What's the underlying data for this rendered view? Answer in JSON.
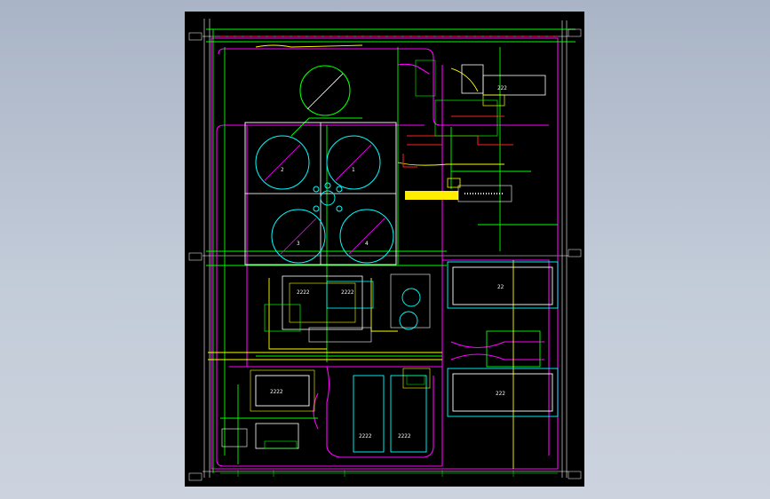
{
  "drawing": {
    "background": "#000000",
    "colors": {
      "boundary": "#ff00ff",
      "road": "#ff00ff",
      "pipe_green": "#00ff00",
      "pipe_yellow": "#ffff00",
      "pipe_red": "#ff2020",
      "grid_white": "#ffffff",
      "cyan": "#00ffff",
      "dim": "#00ff00"
    },
    "tank_labels": [
      "2",
      "1",
      "3",
      "4"
    ],
    "pool_labels": [
      "2222",
      "2222",
      "2222",
      "2222"
    ],
    "building_labels": [
      "22",
      "222",
      "222",
      "2222",
      "2222",
      "222"
    ]
  }
}
